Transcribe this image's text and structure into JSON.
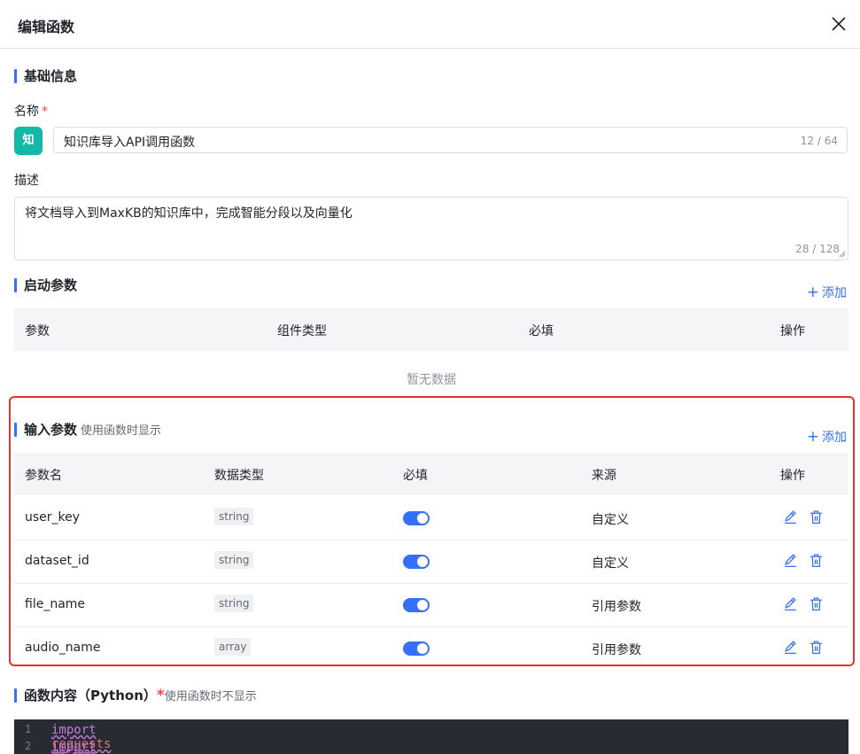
{
  "dialog": {
    "title": "编辑函数",
    "close_icon": "close-icon"
  },
  "basic": {
    "title": "基础信息",
    "name_label": "名称",
    "required_mark": "*",
    "avatar_text": "知",
    "name_value": "知识库导入API调用函数",
    "name_counter": "12 / 64",
    "desc_label": "描述",
    "desc_value": "将文档导入到MaxKB的知识库中，完成智能分段以及向量化",
    "desc_counter": "28 / 128"
  },
  "startup": {
    "title": "启动参数",
    "add_label": "添加",
    "columns": [
      "参数",
      "组件类型",
      "必填",
      "操作"
    ],
    "empty_text": "暂无数据"
  },
  "input": {
    "title": "输入参数",
    "hint": "使用函数时显示",
    "add_label": "添加",
    "columns": [
      "参数名",
      "数据类型",
      "必填",
      "来源",
      "操作"
    ],
    "rows": [
      {
        "name": "user_key",
        "type": "string",
        "required": true,
        "source": "自定义"
      },
      {
        "name": "dataset_id",
        "type": "string",
        "required": true,
        "source": "自定义"
      },
      {
        "name": "file_name",
        "type": "string",
        "required": true,
        "source": "引用参数"
      },
      {
        "name": "audio_name",
        "type": "array",
        "required": true,
        "source": "引用参数"
      }
    ]
  },
  "code": {
    "title": "函数内容（Python）",
    "required_mark": "*",
    "hint": "使用函数时不显示",
    "lines": [
      {
        "num": "1",
        "kw": "import",
        "mod": "requests"
      },
      {
        "num": "2",
        "kw": "import",
        "mod": "json"
      }
    ]
  },
  "colors": {
    "accent": "#3370ff",
    "avatar": "#14b8a6",
    "highlight": "#e7332f"
  }
}
